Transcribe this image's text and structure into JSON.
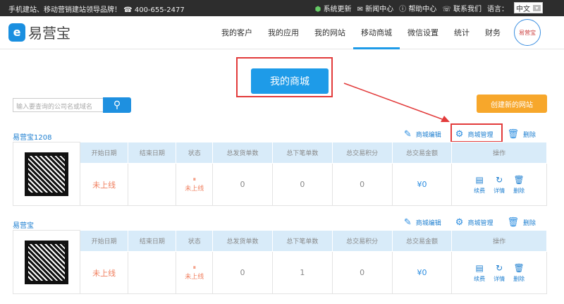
{
  "topbar": {
    "slogan": "手机建站、移动营销建站领导品牌！",
    "phone": "400-655-2477",
    "links": [
      "系统更新",
      "新闻中心",
      "帮助中心",
      "联系我们"
    ],
    "lang_label": "语言：",
    "lang_value": "中文"
  },
  "header": {
    "logo": "易营宝",
    "nav": [
      "我的客户",
      "我的应用",
      "我的网站",
      "移动商城",
      "微信设置",
      "统计",
      "财务"
    ],
    "active": "移动商城",
    "avatar": "易营宝"
  },
  "main": {
    "my_shop_button": "我的商城",
    "search_placeholder": "输入要查询的公司名或域名",
    "create_button": "创建新的网站"
  },
  "actions": {
    "edit": "商城编辑",
    "manage": "商城管理",
    "delete": "删除"
  },
  "columns": [
    "开始日期",
    "结束日期",
    "状态",
    "总发货单数",
    "总下笔单数",
    "总交易积分",
    "总交易金额",
    "操作"
  ],
  "op_labels": [
    "续费",
    "详情",
    "删除"
  ],
  "shops": [
    {
      "name": "易营宝1208",
      "start": "未上线",
      "end": "",
      "status": "未上线",
      "shipped": "0",
      "orders": "0",
      "points": "0",
      "amount": "¥0"
    },
    {
      "name": "易营宝",
      "start": "未上线",
      "end": "",
      "status": "未上线",
      "shipped": "0",
      "orders": "1",
      "points": "0",
      "amount": "¥0"
    }
  ]
}
